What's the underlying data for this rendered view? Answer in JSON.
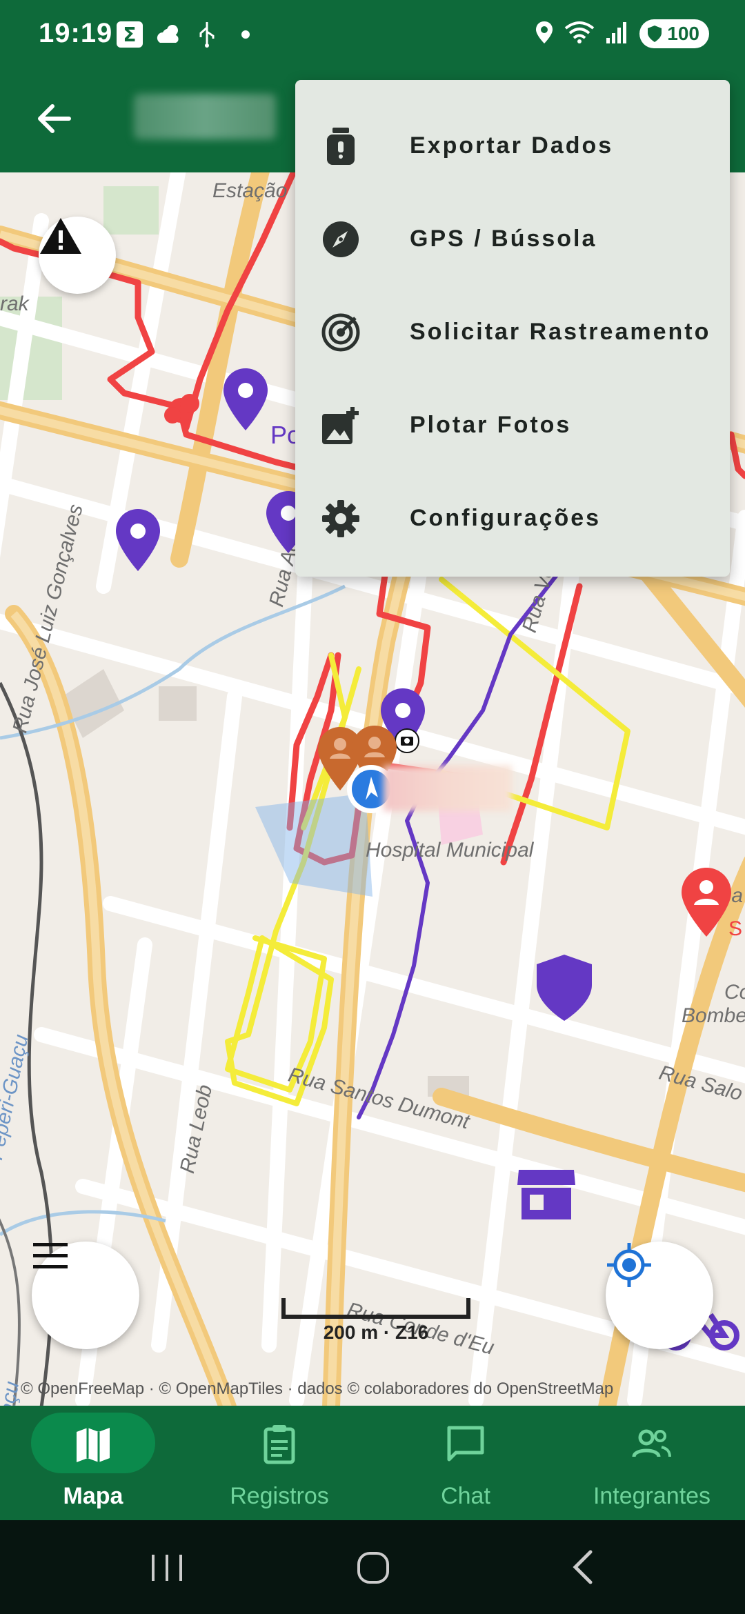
{
  "status_bar": {
    "time": "19:19",
    "battery": "100",
    "icons": [
      "sigma-icon",
      "weather-icon",
      "usb-icon",
      "dot-icon",
      "location-icon",
      "wifi-icon",
      "signal-icon",
      "shield-icon"
    ]
  },
  "map": {
    "street_labels": {
      "estacao": "Estação",
      "rak": "rak",
      "po": "Po",
      "jose_luiz": "Rua José Luiz Gonçalves",
      "acr": "Rua Acr",
      "vereador": "Rua Vereador",
      "hospital": "Hospital Municipal",
      "rua_right": "Rua",
      "s_label": "S",
      "co": "Co",
      "bombe": "Bombe",
      "rua_sal": "Rua Salo",
      "peperi": "Rio Peperi-Guaçu",
      "leob": "Rua Leob",
      "santos_dumont": "Rua Santos Dumont",
      "conde_eu": "Rua Conde d'Eu",
      "acu": "açu"
    },
    "scale": "200 m · Z16",
    "attribution": "© OpenFreeMap · © OpenMapTiles · dados © colaboradores do OpenStreetMap"
  },
  "menu": {
    "items": [
      {
        "label": "Exportar Dados",
        "icon": "export-icon"
      },
      {
        "label": "GPS / Bússola",
        "icon": "compass-icon"
      },
      {
        "label": "Solicitar Rastreamento",
        "icon": "tracking-icon"
      },
      {
        "label": "Plotar Fotos",
        "icon": "add-photo-icon"
      },
      {
        "label": "Configurações",
        "icon": "gear-icon"
      }
    ]
  },
  "bottom_nav": {
    "items": [
      {
        "label": "Mapa",
        "icon": "map-icon",
        "active": true
      },
      {
        "label": "Registros",
        "icon": "clipboard-icon",
        "active": false
      },
      {
        "label": "Chat",
        "icon": "chat-icon",
        "active": false
      },
      {
        "label": "Integrantes",
        "icon": "people-icon",
        "active": false
      }
    ]
  },
  "colors": {
    "primary": "#0e6a3a",
    "active_pill": "#0b8a4c",
    "inactive_nav": "#6fd39b",
    "route_red": "#f04343",
    "route_yellow": "#f4ec3a",
    "route_purple": "#6438c4",
    "pin_orange": "#c8692e"
  }
}
